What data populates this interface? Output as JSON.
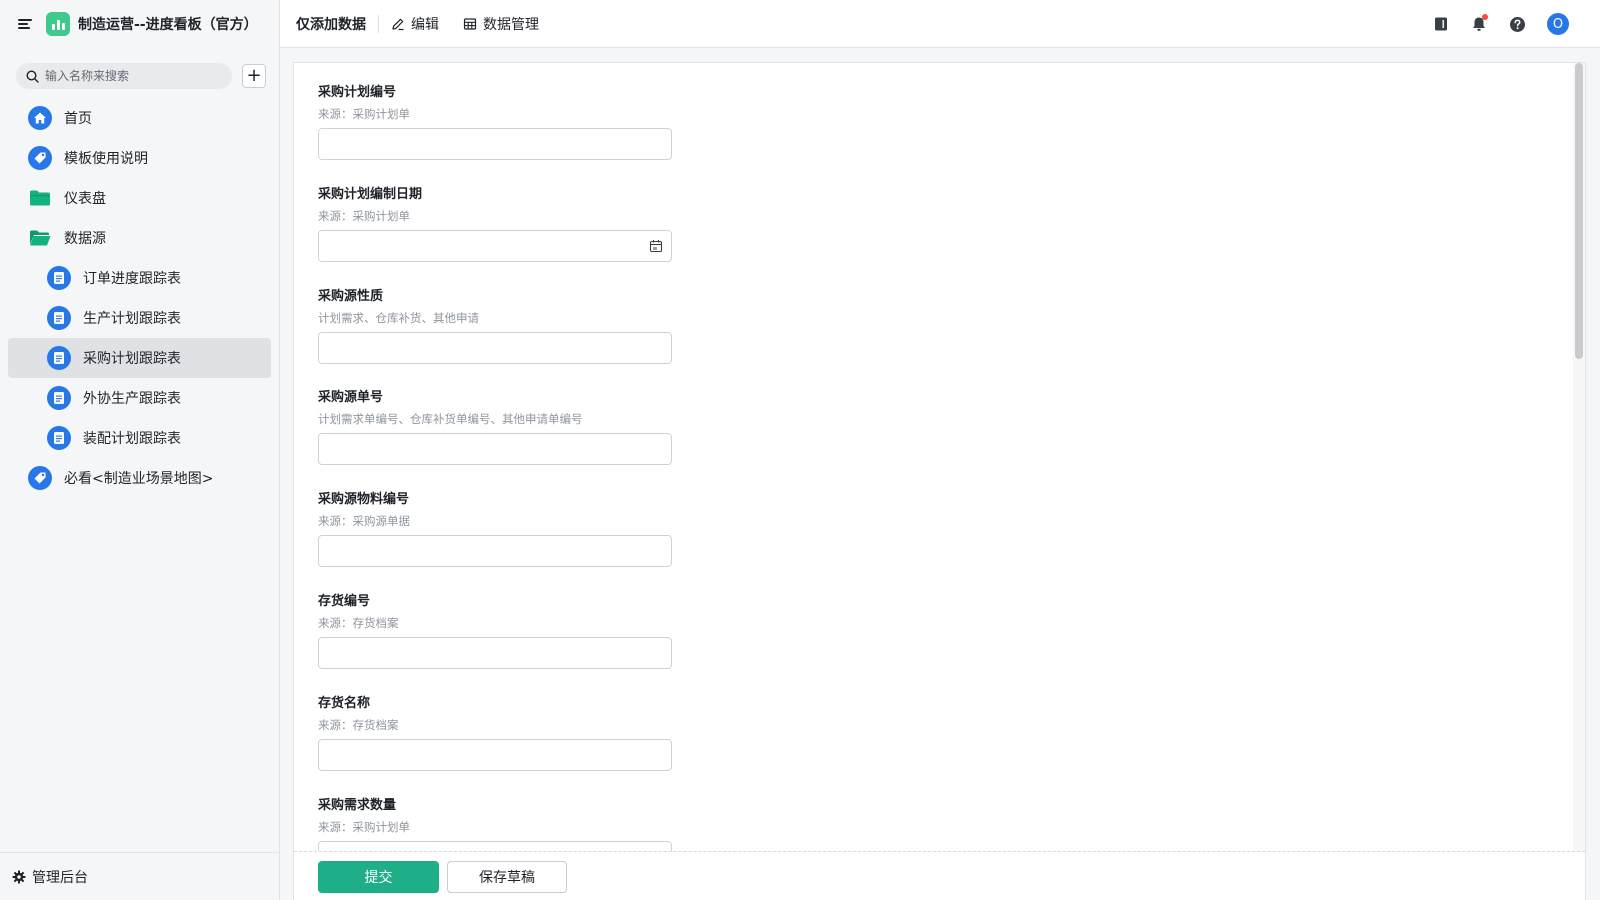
{
  "app": {
    "title": "制造运营--进度看板（官方）"
  },
  "search": {
    "placeholder": "输入名称来搜索"
  },
  "sidebar": {
    "items": [
      {
        "label": "首页",
        "icon": "home-icon"
      },
      {
        "label": "模板使用说明",
        "icon": "tag-icon"
      },
      {
        "label": "仪表盘",
        "icon": "folder-icon"
      },
      {
        "label": "数据源",
        "icon": "folder-open-icon"
      },
      {
        "label": "订单进度跟踪表",
        "icon": "form-icon"
      },
      {
        "label": "生产计划跟踪表",
        "icon": "form-icon"
      },
      {
        "label": "采购计划跟踪表",
        "icon": "form-icon"
      },
      {
        "label": "外协生产跟踪表",
        "icon": "form-icon"
      },
      {
        "label": "装配计划跟踪表",
        "icon": "form-icon"
      },
      {
        "label": "必看<制造业场景地图>",
        "icon": "tag-icon"
      }
    ],
    "footer": "管理后台"
  },
  "topbar": {
    "title": "仅添加数据",
    "edit": "编辑",
    "data_manage": "数据管理",
    "avatar_letter": "O"
  },
  "form": {
    "fields": [
      {
        "label": "采购计划编号",
        "help": "来源：采购计划单",
        "value": ""
      },
      {
        "label": "采购计划编制日期",
        "help": "来源：采购计划单",
        "value": ""
      },
      {
        "label": "采购源性质",
        "help": "计划需求、仓库补货、其他申请",
        "value": ""
      },
      {
        "label": "采购源单号",
        "help": "计划需求单编号、仓库补货单编号、其他申请单编号",
        "value": ""
      },
      {
        "label": "采购源物料编号",
        "help": "来源：采购源单据",
        "value": ""
      },
      {
        "label": "存货编号",
        "help": "来源：存货档案",
        "value": ""
      },
      {
        "label": "存货名称",
        "help": "来源：存货档案",
        "value": ""
      },
      {
        "label": "采购需求数量",
        "help": "来源：采购计划单",
        "value": ""
      }
    ],
    "submit": "提交",
    "save_draft": "保存草稿"
  },
  "colors": {
    "accent": "#1eaf89",
    "brand_blue": "#2777e6",
    "folder_green": "#13b27e"
  }
}
